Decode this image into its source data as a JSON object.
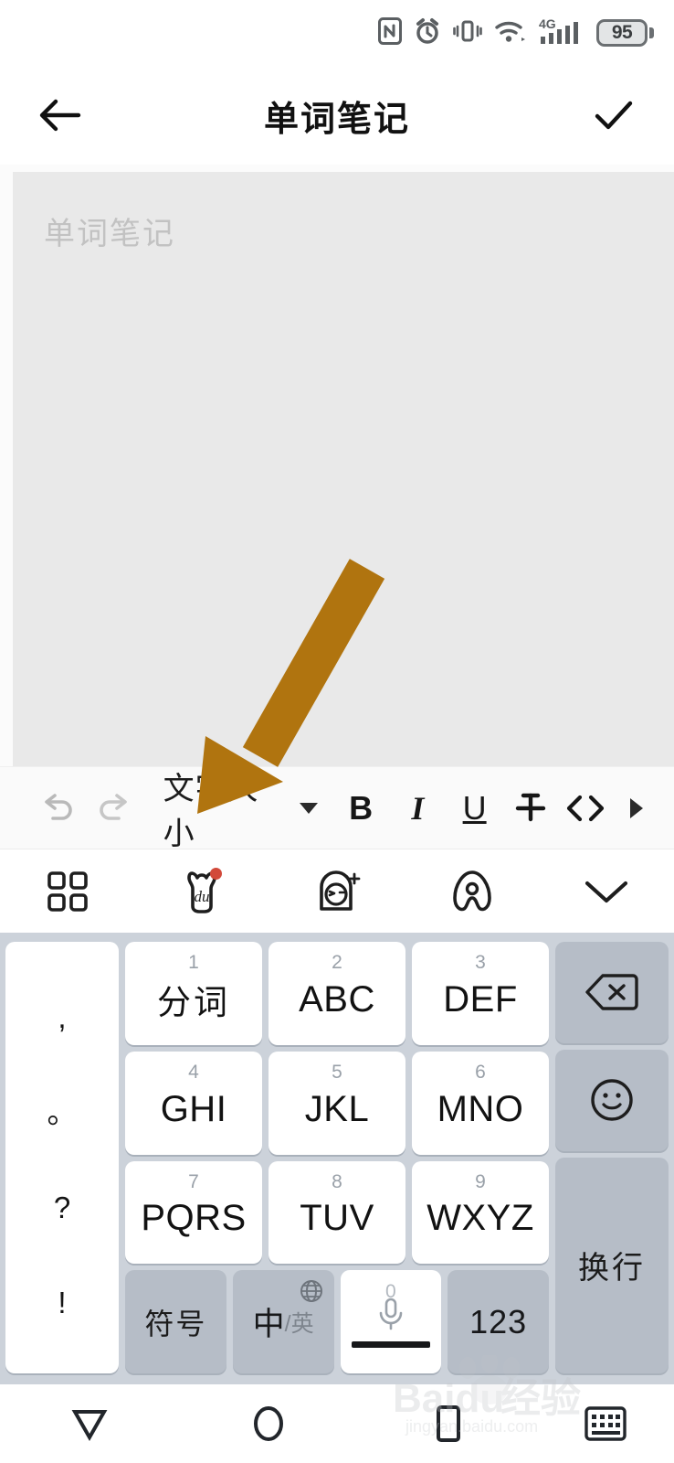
{
  "status_bar": {
    "icons": [
      "nfc-icon",
      "alarm-icon",
      "vibrate-icon",
      "wifi-icon",
      "signal-4g-icon"
    ],
    "network_label": "4G",
    "battery_level": "95"
  },
  "app_bar": {
    "back_icon": "back-arrow-icon",
    "title": "单词笔记",
    "confirm_icon": "checkmark-icon"
  },
  "editor": {
    "placeholder": "单词笔记",
    "value": ""
  },
  "format_toolbar": {
    "undo": "undo-icon",
    "redo": "redo-icon",
    "text_size_label": "文字大小",
    "bold": "B",
    "italic": "I",
    "underline": "U",
    "strikethrough": "strikethrough-icon",
    "code": "<>",
    "more": "more-arrow-icon"
  },
  "ime_tools": [
    {
      "name": "keyboard-panel-grid-icon",
      "label": ""
    },
    {
      "name": "baidu-du-logo-icon",
      "label": "du",
      "badge": true
    },
    {
      "name": "sticker-avatar-icon",
      "label": ""
    },
    {
      "name": "ai-assistant-icon",
      "label": ""
    },
    {
      "name": "collapse-keyboard-chevron-icon",
      "label": ""
    }
  ],
  "keyboard": {
    "punctuation": [
      ",",
      "。",
      "?",
      "!"
    ],
    "rows": [
      [
        {
          "digit": "1",
          "label": "分词",
          "cn": true
        },
        {
          "digit": "2",
          "label": "ABC",
          "cn": false
        },
        {
          "digit": "3",
          "label": "DEF",
          "cn": false
        }
      ],
      [
        {
          "digit": "4",
          "label": "GHI",
          "cn": false
        },
        {
          "digit": "5",
          "label": "JKL",
          "cn": false
        },
        {
          "digit": "6",
          "label": "MNO",
          "cn": false
        }
      ],
      [
        {
          "digit": "7",
          "label": "PQRS",
          "cn": false
        },
        {
          "digit": "8",
          "label": "TUV",
          "cn": false
        },
        {
          "digit": "9",
          "label": "WXYZ",
          "cn": false
        }
      ]
    ],
    "bottom_row": {
      "symbols_label": "符号",
      "lang_main": "中",
      "lang_sub": "/英",
      "lang_globe_icon": "globe-icon",
      "space_digit": "0",
      "space_mic_icon": "microphone-icon",
      "numbers_label": "123"
    },
    "right_column": {
      "backspace_icon": "backspace-icon",
      "emoji_icon": "emoji-smiley-icon",
      "enter_label": "换行"
    }
  },
  "nav_bar": {
    "back_icon": "nav-back-triangle-icon",
    "home_icon": "nav-home-circle-icon",
    "recents_icon": "nav-recents-square-icon",
    "hide_keyboard_icon": "hide-keyboard-icon"
  },
  "watermark": {
    "brand": "Baidu经验",
    "url": "jingyan.baidu.com"
  },
  "annotation": {
    "arrow_color": "#b0740f",
    "points_to": "文字大小"
  }
}
